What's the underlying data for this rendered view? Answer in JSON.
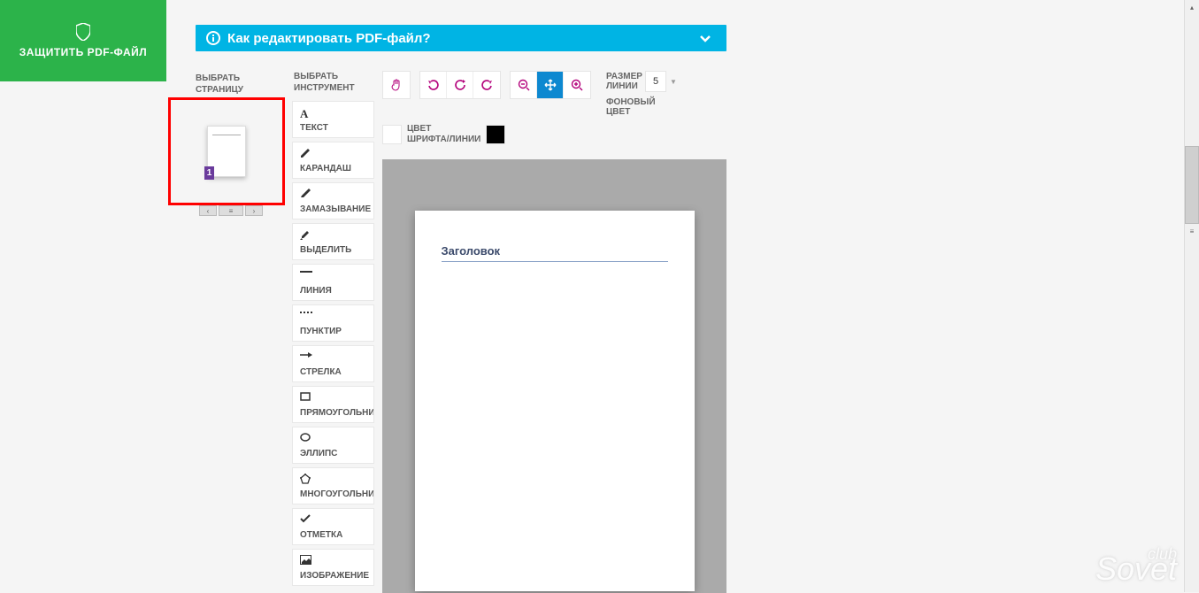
{
  "protect": {
    "label": "ЗАЩИТИТЬ PDF-ФАЙЛ"
  },
  "help_banner": {
    "text": "Как редактировать PDF-файл?"
  },
  "page_selector": {
    "label": "ВЫБРАТЬ\nСТРАНИЦУ",
    "current_page": "1"
  },
  "tool_selector": {
    "label": "ВЫБРАТЬ\nИНСТРУМЕНТ",
    "tools": [
      {
        "name": "ТЕКСТ"
      },
      {
        "name": "КАРАНДАШ"
      },
      {
        "name": "ЗАМАЗЫВАНИЕ"
      },
      {
        "name": "ВЫДЕЛИТЬ"
      },
      {
        "name": "ЛИНИЯ"
      },
      {
        "name": "ПУНКТИР"
      },
      {
        "name": "СТРЕЛКА"
      },
      {
        "name": "ПРЯМОУГОЛЬНИК"
      },
      {
        "name": "ЭЛЛИПС"
      },
      {
        "name": "МНОГОУГОЛЬНИК"
      },
      {
        "name": "ОТМЕТКА"
      },
      {
        "name": "ИЗОБРАЖЕНИЕ"
      }
    ]
  },
  "options": {
    "line_size_label": "РАЗМЕР\nЛИНИИ",
    "line_size_value": "5",
    "bg_color_label": "ФОНОВЫЙ\nЦВЕТ",
    "font_color_label": "ЦВЕТ\nШРИФТА/ЛИНИИ"
  },
  "document": {
    "heading": "Заголовок"
  },
  "watermark": {
    "small": "club",
    "big": "Sovet"
  }
}
